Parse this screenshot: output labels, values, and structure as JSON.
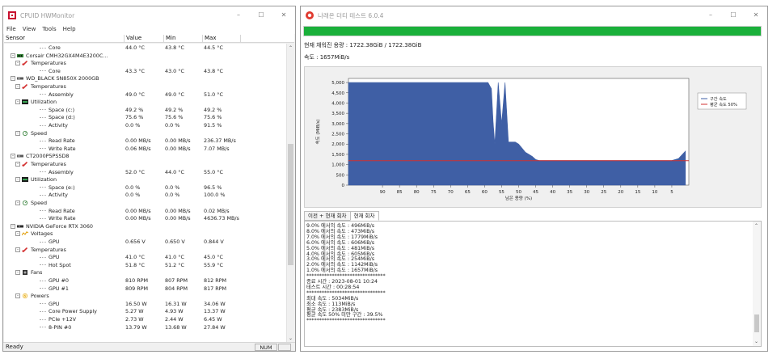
{
  "hwmonitor": {
    "title": "CPUID HWMonitor",
    "controls": [
      "–",
      "☐",
      "✕"
    ],
    "menu": [
      "File",
      "View",
      "Tools",
      "Help"
    ],
    "columns": [
      "Sensor",
      "Value",
      "Min",
      "Max"
    ],
    "rows": [
      {
        "label": "Core",
        "value": "44.0 °C",
        "min": "43.8 °C",
        "max": "44.5 °C",
        "level": 4,
        "icon": "",
        "expander": ""
      },
      {
        "label": "Corsair CMH32GX4M4E3200C...",
        "value": "",
        "min": "",
        "max": "",
        "level": 1,
        "icon": "memory-module",
        "expander": "–"
      },
      {
        "label": "Temperatures",
        "value": "",
        "min": "",
        "max": "",
        "level": 2,
        "icon": "thermometer",
        "expander": "–"
      },
      {
        "label": "Core",
        "value": "43.3 °C",
        "min": "43.0 °C",
        "max": "43.8 °C",
        "level": 4,
        "icon": "",
        "expander": ""
      },
      {
        "label": "WD_BLACK SN850X 2000GB",
        "value": "",
        "min": "",
        "max": "",
        "level": 1,
        "icon": "drive",
        "expander": "–"
      },
      {
        "label": "Temperatures",
        "value": "",
        "min": "",
        "max": "",
        "level": 2,
        "icon": "thermometer",
        "expander": "–"
      },
      {
        "label": "Assembly",
        "value": "49.0 °C",
        "min": "49.0 °C",
        "max": "51.0 °C",
        "level": 4,
        "icon": "",
        "expander": ""
      },
      {
        "label": "Utilization",
        "value": "",
        "min": "",
        "max": "",
        "level": 2,
        "icon": "utilization-chip",
        "expander": "–"
      },
      {
        "label": "Space (c:)",
        "value": "49.2 %",
        "min": "49.2 %",
        "max": "49.2 %",
        "level": 4,
        "icon": "",
        "expander": ""
      },
      {
        "label": "Space (d:)",
        "value": "75.6 %",
        "min": "75.6 %",
        "max": "75.6 %",
        "level": 4,
        "icon": "",
        "expander": ""
      },
      {
        "label": "Activity",
        "value": "0.0 %",
        "min": "0.0 %",
        "max": "91.5 %",
        "level": 4,
        "icon": "",
        "expander": ""
      },
      {
        "label": "Speed",
        "value": "",
        "min": "",
        "max": "",
        "level": 2,
        "icon": "speed-gauge",
        "expander": "–"
      },
      {
        "label": "Read Rate",
        "value": "0.00 MB/s",
        "min": "0.00 MB/s",
        "max": "236.37 MB/s",
        "level": 4,
        "icon": "",
        "expander": ""
      },
      {
        "label": "Write Rate",
        "value": "0.06 MB/s",
        "min": "0.00 MB/s",
        "max": "7.07 MB/s",
        "level": 4,
        "icon": "",
        "expander": ""
      },
      {
        "label": "CT2000P5PSSD8",
        "value": "",
        "min": "",
        "max": "",
        "level": 1,
        "icon": "drive",
        "expander": "–"
      },
      {
        "label": "Temperatures",
        "value": "",
        "min": "",
        "max": "",
        "level": 2,
        "icon": "thermometer",
        "expander": "–"
      },
      {
        "label": "Assembly",
        "value": "52.0 °C",
        "min": "44.0 °C",
        "max": "55.0 °C",
        "level": 4,
        "icon": "",
        "expander": ""
      },
      {
        "label": "Utilization",
        "value": "",
        "min": "",
        "max": "",
        "level": 2,
        "icon": "utilization-chip",
        "expander": "–"
      },
      {
        "label": "Space (e:)",
        "value": "0.0 %",
        "min": "0.0 %",
        "max": "96.5 %",
        "level": 4,
        "icon": "",
        "expander": ""
      },
      {
        "label": "Activity",
        "value": "0.0 %",
        "min": "0.0 %",
        "max": "100.0 %",
        "level": 4,
        "icon": "",
        "expander": ""
      },
      {
        "label": "Speed",
        "value": "",
        "min": "",
        "max": "",
        "level": 2,
        "icon": "speed-gauge",
        "expander": "–"
      },
      {
        "label": "Read Rate",
        "value": "0.00 MB/s",
        "min": "0.00 MB/s",
        "max": "0.02 MB/s",
        "level": 4,
        "icon": "",
        "expander": ""
      },
      {
        "label": "Write Rate",
        "value": "0.00 MB/s",
        "min": "0.00 MB/s",
        "max": "4636.73 MB/s",
        "level": 4,
        "icon": "",
        "expander": ""
      },
      {
        "label": "NVIDIA GeForce RTX 3060",
        "value": "",
        "min": "",
        "max": "",
        "level": 1,
        "icon": "gpu-card",
        "expander": "–"
      },
      {
        "label": "Voltages",
        "value": "",
        "min": "",
        "max": "",
        "level": 2,
        "icon": "voltage",
        "expander": "–"
      },
      {
        "label": "GPU",
        "value": "0.656 V",
        "min": "0.650 V",
        "max": "0.844 V",
        "level": 4,
        "icon": "",
        "expander": ""
      },
      {
        "label": "Temperatures",
        "value": "",
        "min": "",
        "max": "",
        "level": 2,
        "icon": "thermometer",
        "expander": "–"
      },
      {
        "label": "GPU",
        "value": "41.0 °C",
        "min": "41.0 °C",
        "max": "45.0 °C",
        "level": 4,
        "icon": "",
        "expander": ""
      },
      {
        "label": "Hot Spot",
        "value": "51.8 °C",
        "min": "51.2 °C",
        "max": "55.9 °C",
        "level": 4,
        "icon": "",
        "expander": ""
      },
      {
        "label": "Fans",
        "value": "",
        "min": "",
        "max": "",
        "level": 2,
        "icon": "fan",
        "expander": "–"
      },
      {
        "label": "GPU #0",
        "value": "810 RPM",
        "min": "807 RPM",
        "max": "812 RPM",
        "level": 4,
        "icon": "",
        "expander": ""
      },
      {
        "label": "GPU #1",
        "value": "809 RPM",
        "min": "804 RPM",
        "max": "817 RPM",
        "level": 4,
        "icon": "",
        "expander": ""
      },
      {
        "label": "Powers",
        "value": "",
        "min": "",
        "max": "",
        "level": 2,
        "icon": "power",
        "expander": "–"
      },
      {
        "label": "GPU",
        "value": "16.50 W",
        "min": "16.31 W",
        "max": "34.06 W",
        "level": 4,
        "icon": "",
        "expander": ""
      },
      {
        "label": "Core Power Supply",
        "value": "5.27 W",
        "min": "4.93 W",
        "max": "13.37 W",
        "level": 4,
        "icon": "",
        "expander": ""
      },
      {
        "label": "PCIe +12V",
        "value": "2.73 W",
        "min": "2.44 W",
        "max": "6.45 W",
        "level": 4,
        "icon": "",
        "expander": ""
      },
      {
        "label": "8-PIN #0",
        "value": "13.79 W",
        "min": "13.68 W",
        "max": "27.84 W",
        "level": 4,
        "icon": "",
        "expander": ""
      }
    ],
    "status_text": "Ready",
    "num_indicator": "NUM",
    "scroll_position": 0.58
  },
  "nftest": {
    "title": "나래온 더티 테스트 6.0.4",
    "controls": [
      "–",
      "☐",
      "✕"
    ],
    "progress_percent": 100,
    "written_text": "현재 채워진 용량 : 1722.38GiB / 1722.38GiB",
    "speed_text": "속도 : 1657MiB/s",
    "tabs": [
      "이전 + 현재 회차",
      "현재 회차"
    ],
    "active_tab": 1,
    "log_lines": [
      "9.0% 에서의 속도 : 496MiB/s",
      "8.0% 에서의 속도 : 473MiB/s",
      "7.0% 에서의 속도 : 1779MiB/s",
      "6.0% 에서의 속도 : 606MiB/s",
      "5.0% 에서의 속도 : 481MiB/s",
      "4.0% 에서의 속도 : 605MiB/s",
      "3.0% 에서의 속도 : 254MiB/s",
      "2.0% 에서의 속도 : 1142MiB/s",
      "1.0% 에서의 속도 : 1657MiB/s",
      "*******************************",
      "종료 시간 : 2023-08-01 10:24",
      "테스트 시간 : 00:28:54",
      "*******************************",
      "최대 속도 : 5034MiB/s",
      "최소 속도 : 113MiB/s",
      "평균 속도 : 2383MiB/s",
      "평균 속도 50% 미만 구간 : 39.5%",
      "*******************************"
    ],
    "log_scroll_position": 0.95
  },
  "chart_data": {
    "type": "area",
    "ylabel": "속도 (MiB/s)",
    "xlabel": "남은 용량 (%)",
    "x_ticks": [
      90,
      85,
      80,
      75,
      70,
      65,
      60,
      55,
      50,
      45,
      40,
      35,
      30,
      25,
      20,
      15,
      10,
      5
    ],
    "y_ticks": [
      0,
      500,
      1000,
      1500,
      2000,
      2500,
      3000,
      3500,
      4000,
      4500,
      5000
    ],
    "xlim": [
      100,
      0
    ],
    "ylim": [
      0,
      5200
    ],
    "legend_position": "right",
    "series": [
      {
        "name": "구간 속도",
        "color": "#3f5fa5",
        "x": [
          100,
          97,
          95,
          93,
          90,
          87,
          85,
          82,
          80,
          77,
          75,
          72,
          70,
          67,
          65,
          63,
          61,
          60,
          59,
          58,
          57.5,
          57,
          56,
          55,
          54,
          53,
          52,
          51,
          50,
          49,
          48,
          47,
          46,
          45,
          44,
          42,
          40,
          37,
          35,
          32,
          30,
          27,
          25,
          22,
          20,
          17,
          15,
          12,
          10,
          7,
          5,
          3,
          1
        ],
        "y": [
          5000,
          5000,
          5000,
          5000,
          5000,
          5000,
          5000,
          5000,
          5000,
          5000,
          5000,
          5000,
          5000,
          5000,
          5000,
          5000,
          5000,
          5000,
          5000,
          4700,
          3100,
          2000,
          5000,
          3000,
          5000,
          2100,
          2100,
          2100,
          2000,
          1800,
          1600,
          1500,
          1400,
          1250,
          1200,
          1200,
          1200,
          1200,
          1200,
          1200,
          1200,
          1200,
          1200,
          1200,
          1200,
          1200,
          1200,
          1200,
          1200,
          1200,
          1200,
          1300,
          1657
        ]
      },
      {
        "name": "평균 속도 50%",
        "color": "#d03030",
        "x": [
          100,
          0
        ],
        "y": [
          1191,
          1191
        ]
      }
    ]
  }
}
